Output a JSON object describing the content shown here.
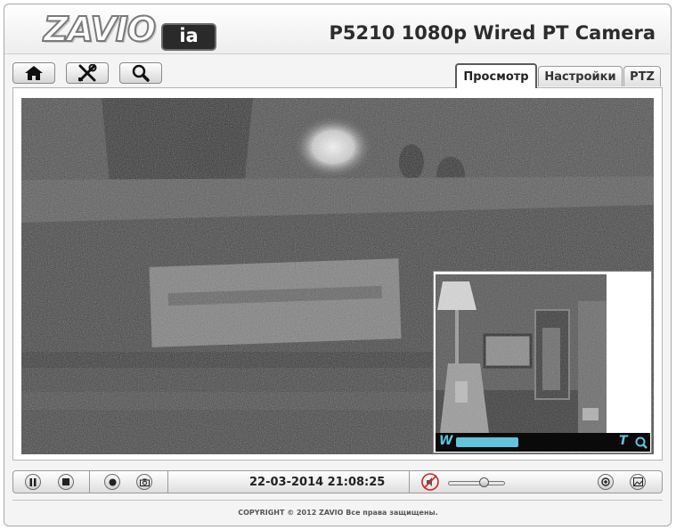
{
  "header": {
    "brand": "ZAVIO",
    "brand_badge": "ia",
    "model_title": "P5210 1080p Wired PT Camera"
  },
  "toolbar": {
    "buttons": [
      {
        "icon": "home-icon"
      },
      {
        "icon": "tools-icon"
      },
      {
        "icon": "search-icon"
      }
    ]
  },
  "tabs": [
    {
      "label": "Просмотр",
      "active": true
    },
    {
      "label": "Настройки",
      "active": false
    },
    {
      "label": "PTZ",
      "active": false
    }
  ],
  "pip": {
    "zoom_wide_label": "W",
    "zoom_tele_label": "T",
    "zoom_level": 0.38
  },
  "controls": {
    "datetime": "22-03-2014 21:08:25",
    "audio_muted": true,
    "volume_level": 0.6,
    "buttons": [
      "pause-icon",
      "stop-icon",
      "record-icon",
      "snapshot-icon",
      "mute-icon",
      "zoom-in-icon",
      "picture-icon"
    ]
  },
  "footer": {
    "copyright": "COPYRIGHT © 2012 ZAVIO Все права защищены."
  },
  "colors": {
    "accent_cyan": "#5fc4dc",
    "mute_red": "#d22222"
  }
}
